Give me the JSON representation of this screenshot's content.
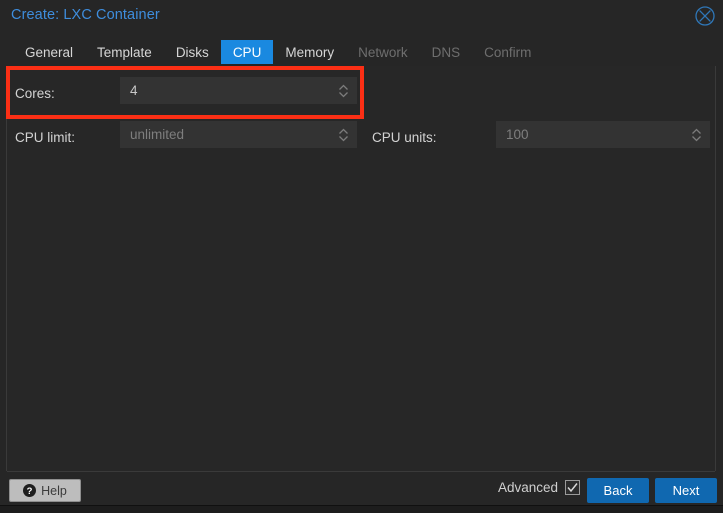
{
  "window": {
    "title": "Create: LXC Container",
    "close_icon": "close-circle-icon"
  },
  "tabs": [
    {
      "label": "General",
      "state": "enabled"
    },
    {
      "label": "Template",
      "state": "enabled"
    },
    {
      "label": "Disks",
      "state": "enabled"
    },
    {
      "label": "CPU",
      "state": "active"
    },
    {
      "label": "Memory",
      "state": "enabled"
    },
    {
      "label": "Network",
      "state": "disabled"
    },
    {
      "label": "DNS",
      "state": "disabled"
    },
    {
      "label": "Confirm",
      "state": "disabled"
    }
  ],
  "form": {
    "cores": {
      "label": "Cores:",
      "value": "4",
      "spinner_icon": "spinner-updown-icon",
      "highlighted": true
    },
    "cpu_limit": {
      "label": "CPU limit:",
      "value": "",
      "placeholder": "unlimited",
      "spinner_icon": "spinner-updown-icon"
    },
    "cpu_units": {
      "label": "CPU units:",
      "value": "100",
      "spinner_icon": "spinner-updown-icon"
    }
  },
  "footer": {
    "help_label": "Help",
    "help_icon": "question-mark-icon",
    "advanced_label": "Advanced",
    "advanced_checked": true,
    "back_label": "Back",
    "next_label": "Next"
  },
  "colors": {
    "accent_blue": "#1a89e0",
    "button_blue": "#1068b0",
    "title_blue": "#3e8ddd",
    "highlight_red": "#fb2f15",
    "window_bg": "#262626",
    "field_bg": "#333333"
  }
}
